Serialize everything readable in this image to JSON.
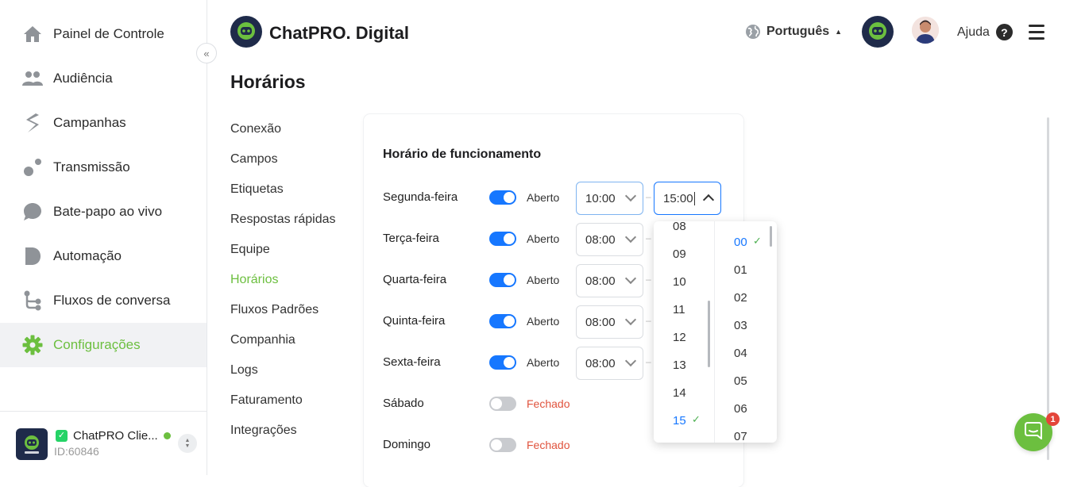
{
  "sidebar": {
    "items": [
      {
        "label": "Painel de Controle",
        "icon": "home-icon"
      },
      {
        "label": "Audiência",
        "icon": "users-icon"
      },
      {
        "label": "Campanhas",
        "icon": "campaign-icon"
      },
      {
        "label": "Transmissão",
        "icon": "broadcast-icon"
      },
      {
        "label": "Bate-papo ao vivo",
        "icon": "chat-icon"
      },
      {
        "label": "Automação",
        "icon": "automation-icon"
      },
      {
        "label": "Fluxos de conversa",
        "icon": "flow-icon"
      },
      {
        "label": "Configurações",
        "icon": "gear-icon",
        "active": true
      }
    ],
    "account": {
      "name": "ChatPRO Clie...",
      "id": "ID:60846",
      "status_color": "#6cbf3f"
    }
  },
  "header": {
    "brand": "ChatPRO. Digital",
    "language": "Português",
    "help": "Ajuda"
  },
  "page_title": "Horários",
  "submenu": [
    "Conexão",
    "Campos",
    "Etiquetas",
    "Respostas rápidas",
    "Equipe",
    "Horários",
    "Fluxos Padrões",
    "Companhia",
    "Logs",
    "Faturamento",
    "Integrações"
  ],
  "schedule": {
    "title": "Horário de funcionamento",
    "days": [
      {
        "day": "Segunda-feira",
        "status": "Aberto",
        "start": "10:00",
        "end": "15:00"
      },
      {
        "day": "Terça-feira",
        "status": "Aberto",
        "start": "08:00"
      },
      {
        "day": "Quarta-feira",
        "status": "Aberto",
        "start": "08:00"
      },
      {
        "day": "Quinta-feira",
        "status": "Aberto",
        "start": "08:00"
      },
      {
        "day": "Sexta-feira",
        "status": "Aberto",
        "start": "08:00"
      },
      {
        "day": "Sábado",
        "status": "Fechado"
      },
      {
        "day": "Domingo",
        "status": "Fechado"
      }
    ]
  },
  "picker": {
    "hours": [
      "08",
      "09",
      "10",
      "11",
      "12",
      "13",
      "14",
      "15"
    ],
    "minutes": [
      "00",
      "01",
      "02",
      "03",
      "04",
      "05",
      "06",
      "07"
    ],
    "selected_hour": "15",
    "selected_minute": "00"
  },
  "chat_badge": "1",
  "colors": {
    "accent_green": "#6cbf3f",
    "toggle_blue": "#1677ff",
    "closed_red": "#e0533d"
  }
}
